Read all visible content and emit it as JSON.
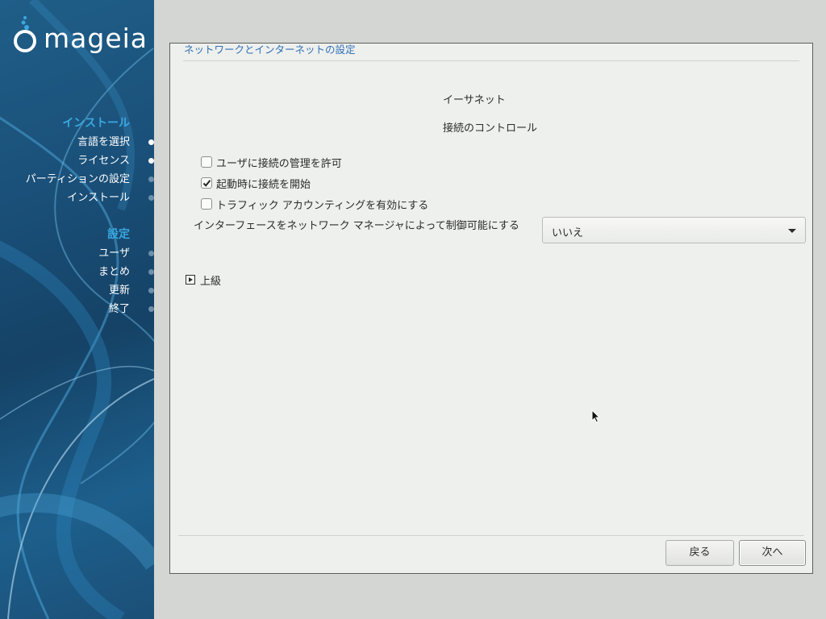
{
  "app": {
    "logo_text": "mageia"
  },
  "sidebar": {
    "groups": [
      {
        "heading": "インストール",
        "items": [
          {
            "label": "言語を選択",
            "state": "done"
          },
          {
            "label": "ライセンス",
            "state": "done"
          },
          {
            "label": "パーティションの設定",
            "state": "pending"
          },
          {
            "label": "インストール",
            "state": "pending"
          }
        ]
      },
      {
        "heading": "設定",
        "items": [
          {
            "label": "ユーザ",
            "state": "pending"
          },
          {
            "label": "まとめ",
            "state": "pending"
          },
          {
            "label": "更新",
            "state": "pending"
          },
          {
            "label": "終了",
            "state": "pending"
          }
        ]
      }
    ]
  },
  "main": {
    "title": "ネットワークとインターネットの設定",
    "heading": "イーサネット",
    "subheading": "接続のコントロール",
    "options": [
      {
        "label": "ユーザに接続の管理を許可",
        "checked": false
      },
      {
        "label": "起動時に接続を開始",
        "checked": true
      },
      {
        "label": "トラフィック アカウンティングを有効にする",
        "checked": false
      }
    ],
    "nm_control": {
      "label": "インターフェースをネットワーク マネージャによって制御可能にする",
      "value": "いいえ"
    },
    "advanced_label": "上級"
  },
  "buttons": {
    "back": "戻る",
    "next": "次へ"
  },
  "colors": {
    "accent": "#2f6fb6",
    "sidebar_heading": "#3aa8e0",
    "sidebar_bg": "#1a5079"
  }
}
